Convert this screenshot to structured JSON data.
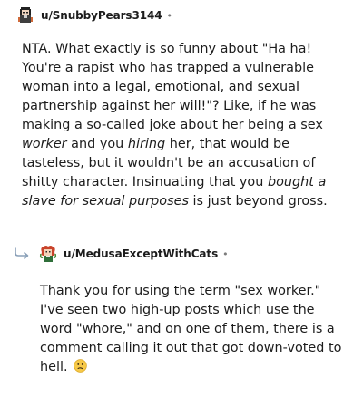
{
  "comment1": {
    "username": "u/SnubbyPears3144",
    "dot": "•",
    "segments": [
      {
        "text": "NTA. What exactly is so funny about \"Ha ha! You're a rapist who has trapped a vulnerable woman into a legal, emotional, and sexual partnership against her will!\"? Like, if he was making a so-called joke about her being a sex ",
        "italic": false
      },
      {
        "text": "worker",
        "italic": true
      },
      {
        "text": " and you ",
        "italic": false
      },
      {
        "text": "hiring",
        "italic": true
      },
      {
        "text": " her, that would be tasteless, but it wouldn't be an accusation of shitty character. Insinuating that you ",
        "italic": false
      },
      {
        "text": "bought a slave for sexual purposes",
        "italic": true
      },
      {
        "text": " is just beyond gross.",
        "italic": false
      }
    ]
  },
  "comment2": {
    "username": "u/MedusaExceptWithCats",
    "dot": "•",
    "text": "Thank you for using the term \"sex worker.\" I've seen two high-up posts which use the word \"whore,\" and on one of them, there is a comment calling it out that got down-voted to hell.",
    "emoji": "confused-face"
  }
}
